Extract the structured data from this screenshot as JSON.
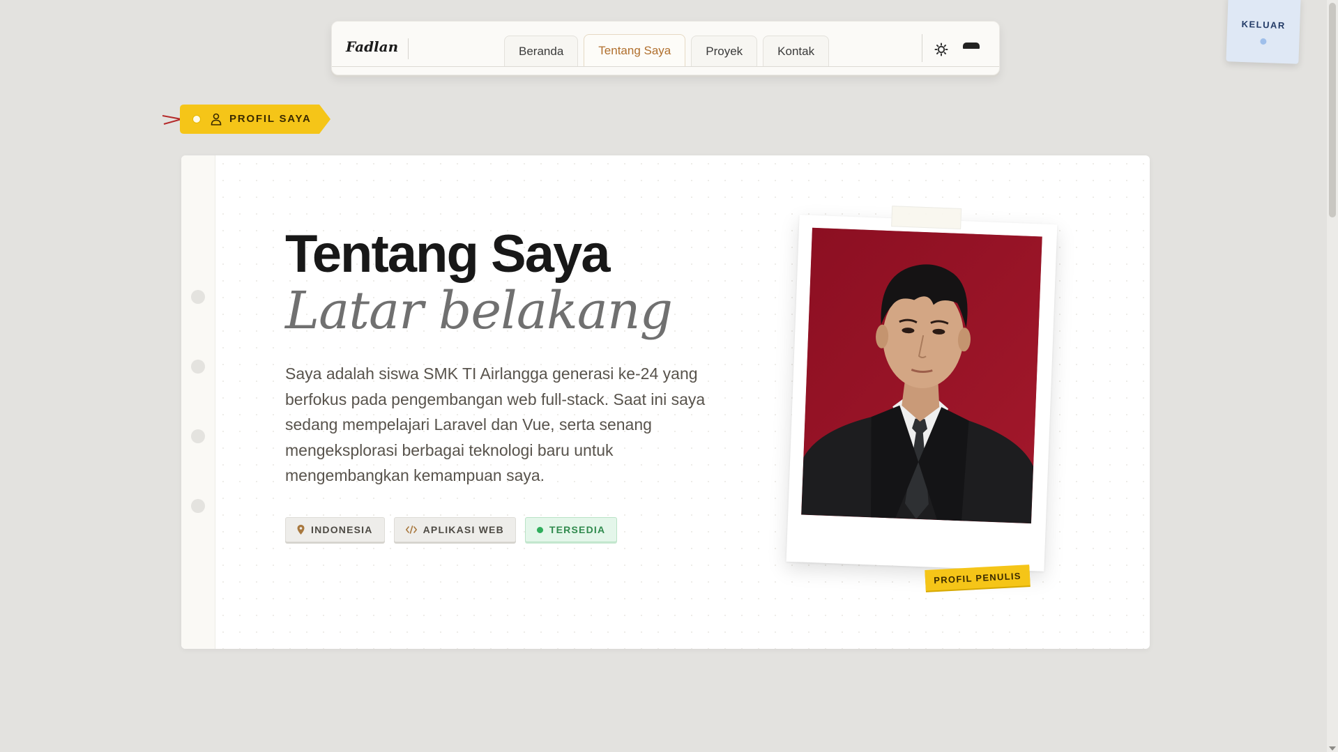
{
  "nav": {
    "brand": "Fadlan",
    "tabs": [
      {
        "label": "Beranda",
        "active": false
      },
      {
        "label": "Tentang Saya",
        "active": true
      },
      {
        "label": "Proyek",
        "active": false
      },
      {
        "label": "Kontak",
        "active": false
      }
    ],
    "theme_icon": "sun-icon",
    "menu_icon": "menu-icon"
  },
  "logout": {
    "label": "KELUAR"
  },
  "section_tag": {
    "label": "PROFIL SAYA",
    "icon": "person-icon",
    "color": "#f5c518"
  },
  "about": {
    "title": "Tentang Saya",
    "subtitle": "Latar belakang",
    "description": "Saya adalah siswa SMK TI Airlangga generasi ke-24 yang berfokus pada pengembangan web full-stack. Saat ini saya sedang mempelajari Laravel dan Vue, serta senang mengeksplorasi berbagai teknologi baru untuk mengembangkan kemampuan saya.",
    "chips": [
      {
        "label": "INDONESIA",
        "icon": "location-pin-icon"
      },
      {
        "label": "APLIKASI WEB",
        "icon": "code-icon"
      },
      {
        "label": "TERSEDIA",
        "icon": "status-dot-icon",
        "color": "#2fae5c"
      }
    ]
  },
  "photo": {
    "caption": "PROFIL PENULIS",
    "background_color": "#8e1023"
  },
  "colors": {
    "accent": "#b06f2d",
    "highlight": "#f5c518",
    "background": "#e3e2df"
  }
}
